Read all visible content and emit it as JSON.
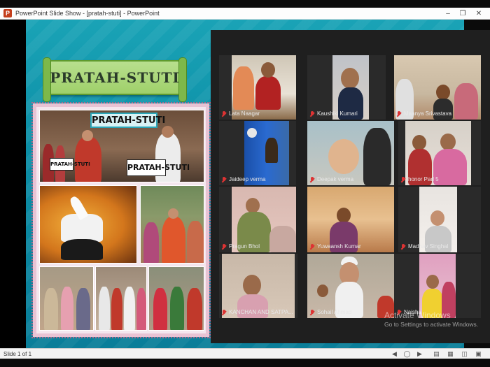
{
  "window": {
    "title": "PowerPoint Slide Show - [pratah-stuti] - PowerPoint",
    "minimize_glyph": "–",
    "maximize_glyph": "❐",
    "close_glyph": "✕",
    "app_icon": "P"
  },
  "slide": {
    "banner_title": "PRATAH-STUTI",
    "sign_top": "PRATAH-STUTI",
    "sign_podium_small": "PRATAH-STUTI",
    "sign_podium_large": "PRATAH-STUTI"
  },
  "meeting": {
    "participants": [
      {
        "name": "Lata Naagar"
      },
      {
        "name": "Kaushiki Kumari"
      },
      {
        "name": "Maanya Srivastava"
      },
      {
        "name": "Jaideep verma"
      },
      {
        "name": "Deepak verma"
      },
      {
        "name": "honor Pad 5"
      },
      {
        "name": "Pragun Bhol"
      },
      {
        "name": "Yuwaansh Kumar"
      },
      {
        "name": "Madhav Singhal"
      },
      {
        "name": "KANCHAN AND SATPA..."
      },
      {
        "name": "Sohail Ahmad"
      },
      {
        "name": "Naisha"
      }
    ]
  },
  "watermark": {
    "title": "Activate Windows",
    "subtitle": "Go to Settings to activate Windows."
  },
  "statusbar": {
    "slide_count": "Slide 1 of 1"
  },
  "colors": {
    "slide_teal": "#0c8ea6",
    "banner_green": "#9fd06a",
    "meeting_bg": "#1f1f1f",
    "muted_mic": "#dd3333"
  }
}
